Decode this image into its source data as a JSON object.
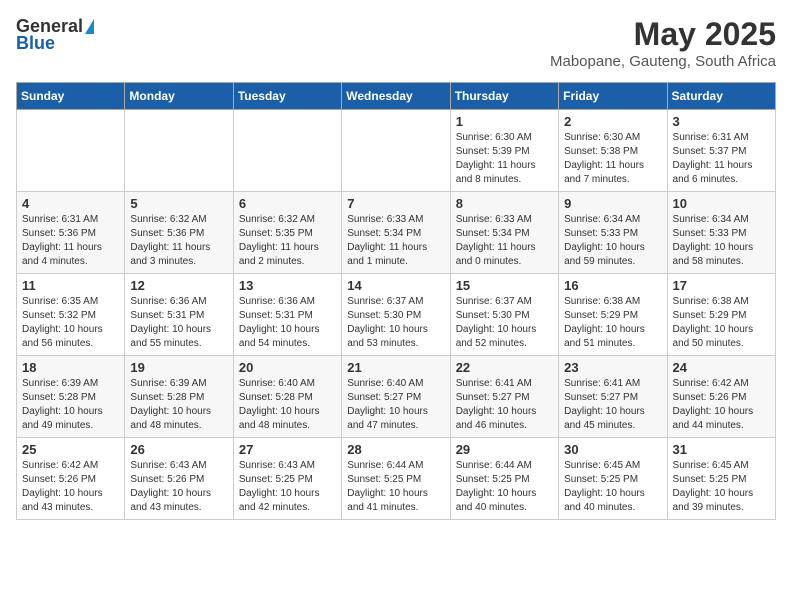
{
  "header": {
    "logo_general": "General",
    "logo_blue": "Blue",
    "month_year": "May 2025",
    "location": "Mabopane, Gauteng, South Africa"
  },
  "days_of_week": [
    "Sunday",
    "Monday",
    "Tuesday",
    "Wednesday",
    "Thursday",
    "Friday",
    "Saturday"
  ],
  "weeks": [
    [
      {
        "day": "",
        "info": ""
      },
      {
        "day": "",
        "info": ""
      },
      {
        "day": "",
        "info": ""
      },
      {
        "day": "",
        "info": ""
      },
      {
        "day": "1",
        "info": "Sunrise: 6:30 AM\nSunset: 5:39 PM\nDaylight: 11 hours\nand 8 minutes."
      },
      {
        "day": "2",
        "info": "Sunrise: 6:30 AM\nSunset: 5:38 PM\nDaylight: 11 hours\nand 7 minutes."
      },
      {
        "day": "3",
        "info": "Sunrise: 6:31 AM\nSunset: 5:37 PM\nDaylight: 11 hours\nand 6 minutes."
      }
    ],
    [
      {
        "day": "4",
        "info": "Sunrise: 6:31 AM\nSunset: 5:36 PM\nDaylight: 11 hours\nand 4 minutes."
      },
      {
        "day": "5",
        "info": "Sunrise: 6:32 AM\nSunset: 5:36 PM\nDaylight: 11 hours\nand 3 minutes."
      },
      {
        "day": "6",
        "info": "Sunrise: 6:32 AM\nSunset: 5:35 PM\nDaylight: 11 hours\nand 2 minutes."
      },
      {
        "day": "7",
        "info": "Sunrise: 6:33 AM\nSunset: 5:34 PM\nDaylight: 11 hours\nand 1 minute."
      },
      {
        "day": "8",
        "info": "Sunrise: 6:33 AM\nSunset: 5:34 PM\nDaylight: 11 hours\nand 0 minutes."
      },
      {
        "day": "9",
        "info": "Sunrise: 6:34 AM\nSunset: 5:33 PM\nDaylight: 10 hours\nand 59 minutes."
      },
      {
        "day": "10",
        "info": "Sunrise: 6:34 AM\nSunset: 5:33 PM\nDaylight: 10 hours\nand 58 minutes."
      }
    ],
    [
      {
        "day": "11",
        "info": "Sunrise: 6:35 AM\nSunset: 5:32 PM\nDaylight: 10 hours\nand 56 minutes."
      },
      {
        "day": "12",
        "info": "Sunrise: 6:36 AM\nSunset: 5:31 PM\nDaylight: 10 hours\nand 55 minutes."
      },
      {
        "day": "13",
        "info": "Sunrise: 6:36 AM\nSunset: 5:31 PM\nDaylight: 10 hours\nand 54 minutes."
      },
      {
        "day": "14",
        "info": "Sunrise: 6:37 AM\nSunset: 5:30 PM\nDaylight: 10 hours\nand 53 minutes."
      },
      {
        "day": "15",
        "info": "Sunrise: 6:37 AM\nSunset: 5:30 PM\nDaylight: 10 hours\nand 52 minutes."
      },
      {
        "day": "16",
        "info": "Sunrise: 6:38 AM\nSunset: 5:29 PM\nDaylight: 10 hours\nand 51 minutes."
      },
      {
        "day": "17",
        "info": "Sunrise: 6:38 AM\nSunset: 5:29 PM\nDaylight: 10 hours\nand 50 minutes."
      }
    ],
    [
      {
        "day": "18",
        "info": "Sunrise: 6:39 AM\nSunset: 5:28 PM\nDaylight: 10 hours\nand 49 minutes."
      },
      {
        "day": "19",
        "info": "Sunrise: 6:39 AM\nSunset: 5:28 PM\nDaylight: 10 hours\nand 48 minutes."
      },
      {
        "day": "20",
        "info": "Sunrise: 6:40 AM\nSunset: 5:28 PM\nDaylight: 10 hours\nand 48 minutes."
      },
      {
        "day": "21",
        "info": "Sunrise: 6:40 AM\nSunset: 5:27 PM\nDaylight: 10 hours\nand 47 minutes."
      },
      {
        "day": "22",
        "info": "Sunrise: 6:41 AM\nSunset: 5:27 PM\nDaylight: 10 hours\nand 46 minutes."
      },
      {
        "day": "23",
        "info": "Sunrise: 6:41 AM\nSunset: 5:27 PM\nDaylight: 10 hours\nand 45 minutes."
      },
      {
        "day": "24",
        "info": "Sunrise: 6:42 AM\nSunset: 5:26 PM\nDaylight: 10 hours\nand 44 minutes."
      }
    ],
    [
      {
        "day": "25",
        "info": "Sunrise: 6:42 AM\nSunset: 5:26 PM\nDaylight: 10 hours\nand 43 minutes."
      },
      {
        "day": "26",
        "info": "Sunrise: 6:43 AM\nSunset: 5:26 PM\nDaylight: 10 hours\nand 43 minutes."
      },
      {
        "day": "27",
        "info": "Sunrise: 6:43 AM\nSunset: 5:25 PM\nDaylight: 10 hours\nand 42 minutes."
      },
      {
        "day": "28",
        "info": "Sunrise: 6:44 AM\nSunset: 5:25 PM\nDaylight: 10 hours\nand 41 minutes."
      },
      {
        "day": "29",
        "info": "Sunrise: 6:44 AM\nSunset: 5:25 PM\nDaylight: 10 hours\nand 40 minutes."
      },
      {
        "day": "30",
        "info": "Sunrise: 6:45 AM\nSunset: 5:25 PM\nDaylight: 10 hours\nand 40 minutes."
      },
      {
        "day": "31",
        "info": "Sunrise: 6:45 AM\nSunset: 5:25 PM\nDaylight: 10 hours\nand 39 minutes."
      }
    ]
  ]
}
